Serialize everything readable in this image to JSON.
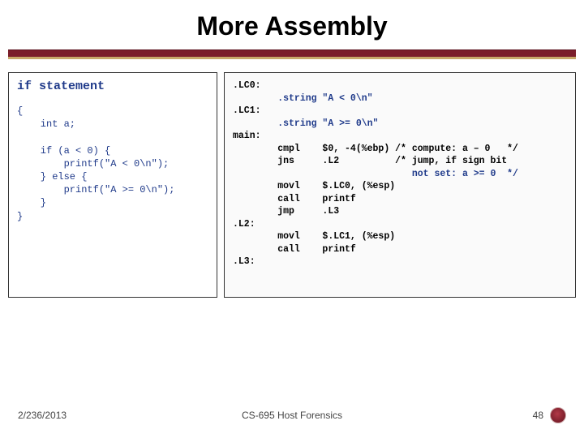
{
  "title": "More Assembly",
  "left": {
    "heading": "if statement",
    "code": "{\n    int a;\n\n    if (a < 0) {\n        printf(\"A < 0\\n\");\n    } else {\n        printf(\"A >= 0\\n\");\n    }\n}"
  },
  "asm": {
    "l0": ".LC0:",
    "l1": "        .string \"A < 0\\n\"",
    "l2": ".LC1:",
    "l3": "        .string \"A >= 0\\n\"",
    "l4": "",
    "l5": "main:",
    "l6": "        cmpl    $0, -4(%ebp) /* compute: a – 0   */",
    "l7": "        jns     .L2          /* jump, if sign bit",
    "l8": "                                not set: a >= 0  */",
    "l9": "        movl    $.LC0, (%esp)",
    "l10": "        call    printf",
    "l11": "        jmp     .L3",
    "l12": ".L2:",
    "l13": "        movl    $.LC1, (%esp)",
    "l14": "        call    printf",
    "l15": ".L3:"
  },
  "footer": {
    "date": "2/236/2013",
    "course": "CS-695 Host Forensics",
    "page": "48"
  }
}
